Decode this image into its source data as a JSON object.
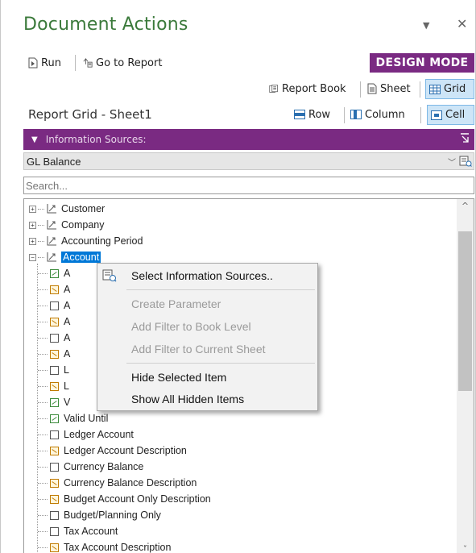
{
  "panel": {
    "title": "Document Actions",
    "dropdown_glyph": "▼",
    "close_glyph": "✕"
  },
  "toolbar": {
    "run_label": "Run",
    "goto_label": "Go to Report",
    "mode_badge": "DESIGN MODE"
  },
  "views": {
    "report_book": "Report Book",
    "sheet": "Sheet",
    "grid": "Grid",
    "active": "Grid"
  },
  "report": {
    "title": "Report Grid - Sheet1",
    "row_label": "Row",
    "column_label": "Column",
    "cell_label": "Cell",
    "active": "Cell"
  },
  "info_sources": {
    "header": "Information Sources:",
    "selected": "GL Balance",
    "search_placeholder": "Search..."
  },
  "tree": {
    "nodes": [
      {
        "label": "Customer",
        "expanded": false
      },
      {
        "label": "Company",
        "expanded": false
      },
      {
        "label": "Accounting Period",
        "expanded": false
      },
      {
        "label": "Account",
        "expanded": true,
        "selected": true
      }
    ],
    "children": [
      {
        "label": "A",
        "state": "green"
      },
      {
        "label": "A",
        "state": "orange"
      },
      {
        "label": "A",
        "state": "none"
      },
      {
        "label": "A",
        "state": "orange"
      },
      {
        "label": "A",
        "state": "none"
      },
      {
        "label": "A",
        "state": "orange"
      },
      {
        "label": "L",
        "state": "none"
      },
      {
        "label": "L",
        "state": "orange"
      },
      {
        "label": "V",
        "state": "green"
      },
      {
        "label": "Valid Until",
        "state": "green"
      },
      {
        "label": "Ledger Account",
        "state": "none"
      },
      {
        "label": "Ledger Account Description",
        "state": "orange"
      },
      {
        "label": "Currency Balance",
        "state": "none"
      },
      {
        "label": "Currency Balance Description",
        "state": "orange"
      },
      {
        "label": "Budget Account Only Description",
        "state": "orange"
      },
      {
        "label": "Budget/Planning Only",
        "state": "none"
      },
      {
        "label": "Tax Account",
        "state": "none"
      },
      {
        "label": "Tax Account Description",
        "state": "orange"
      }
    ]
  },
  "context_menu": {
    "items": [
      {
        "label": "Select Information Sources..",
        "enabled": true
      },
      {
        "label": "Create Parameter",
        "enabled": false
      },
      {
        "label": "Add Filter to Book Level",
        "enabled": false
      },
      {
        "label": "Add Filter to Current Sheet",
        "enabled": false
      },
      {
        "label": "Hide Selected Item",
        "enabled": true
      },
      {
        "label": "Show All Hidden Items",
        "enabled": true
      }
    ]
  },
  "colors": {
    "title_green": "#3b7a3b",
    "brand_purple": "#7a2a82",
    "active_blue": "#cde5f7",
    "selection_blue": "#0078d7"
  }
}
